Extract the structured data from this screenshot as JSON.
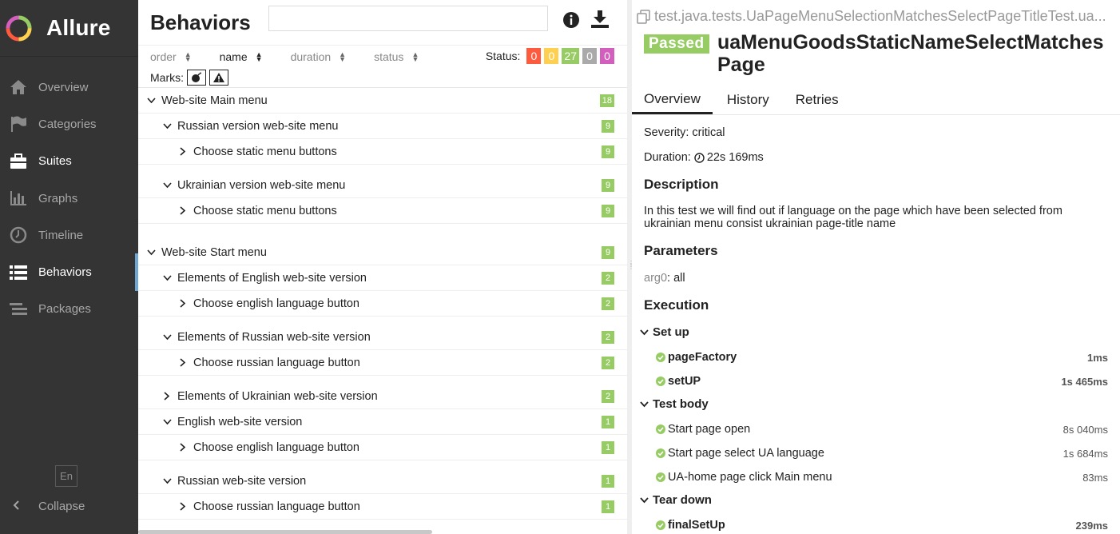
{
  "app": {
    "name": "Allure",
    "colors": {
      "sidebar": "#343434",
      "passed": "#97cc64",
      "failed": "#fd5a3e",
      "broken": "#ffd050",
      "skipped": "#aaaaaa",
      "unknown": "#d35ebe",
      "selected": "#6ea6d4"
    }
  },
  "sidebar": {
    "items": [
      {
        "label": "Overview",
        "icon": "home-icon"
      },
      {
        "label": "Categories",
        "icon": "flag-icon"
      },
      {
        "label": "Suites",
        "icon": "briefcase-icon"
      },
      {
        "label": "Graphs",
        "icon": "bar-chart-icon"
      },
      {
        "label": "Timeline",
        "icon": "clock-icon"
      },
      {
        "label": "Behaviors",
        "icon": "list-icon"
      },
      {
        "label": "Packages",
        "icon": "packages-icon"
      }
    ],
    "language": "En",
    "collapse": "Collapse"
  },
  "middle": {
    "title": "Behaviors",
    "search_value": "",
    "sort": [
      {
        "label": "order"
      },
      {
        "label": "name"
      },
      {
        "label": "duration"
      },
      {
        "label": "status"
      }
    ],
    "status_label": "Status:",
    "status_counts": [
      {
        "value": "0",
        "color": "#fd5a3e"
      },
      {
        "value": "0",
        "color": "#ffd050"
      },
      {
        "value": "27",
        "color": "#97cc64"
      },
      {
        "value": "0",
        "color": "#aaaaaa"
      },
      {
        "value": "0",
        "color": "#d35ebe"
      }
    ],
    "marks_label": "Marks:",
    "tree": [
      {
        "label": "Web-site Main menu",
        "count": "18",
        "level": 0,
        "expanded": true
      },
      {
        "label": "Russian version web-site menu",
        "count": "9",
        "level": 1,
        "expanded": true
      },
      {
        "label": "Choose static menu buttons",
        "count": "9",
        "level": 2,
        "expanded": false
      },
      {
        "label": "Ukrainian version web-site menu",
        "count": "9",
        "level": 1,
        "expanded": true
      },
      {
        "label": "Choose static menu buttons",
        "count": "9",
        "level": 2,
        "expanded": false
      },
      {
        "label": "Web-site Start menu",
        "count": "9",
        "level": 0,
        "expanded": true
      },
      {
        "label": "Elements of English web-site version",
        "count": "2",
        "level": 1,
        "expanded": true
      },
      {
        "label": "Choose english language button",
        "count": "2",
        "level": 2,
        "expanded": false
      },
      {
        "label": "Elements of Russian web-site version",
        "count": "2",
        "level": 1,
        "expanded": true
      },
      {
        "label": "Choose russian language button",
        "count": "2",
        "level": 2,
        "expanded": false
      },
      {
        "label": "Elements of Ukrainian web-site version",
        "count": "2",
        "level": 1,
        "expanded": false
      },
      {
        "label": "English web-site version",
        "count": "1",
        "level": 1,
        "expanded": true
      },
      {
        "label": "Choose english language button",
        "count": "1",
        "level": 2,
        "expanded": false
      },
      {
        "label": "Russian web-site version",
        "count": "1",
        "level": 1,
        "expanded": true
      },
      {
        "label": "Choose russian language button",
        "count": "1",
        "level": 2,
        "expanded": false
      }
    ]
  },
  "detail": {
    "path": "test.java.tests.UaPageMenuSelectionMatchesSelectPageTitleTest.ua...",
    "status": "Passed",
    "name": "uaMenuGoodsStaticNameSelectMatchesPage",
    "tabs": [
      "Overview",
      "History",
      "Retries"
    ],
    "severity": "Severity: critical",
    "duration_label": "Duration:",
    "duration": "22s 169ms",
    "description_title": "Description",
    "description": "In this test we will find out if language on the page which have been selected from ukrainian menu consist ukrainian page-title name",
    "parameters_title": "Parameters",
    "param_key": "arg0",
    "param_value": ": all",
    "execution_title": "Execution",
    "groups": [
      {
        "title": "Set up",
        "steps": [
          {
            "name": "pageFactory",
            "time": "1ms"
          },
          {
            "name": "setUP",
            "time": "1s 465ms"
          }
        ]
      },
      {
        "title": "Test body",
        "steps": [
          {
            "name": "Start page open",
            "time": "8s 040ms"
          },
          {
            "name": "Start page select UA language",
            "time": "1s 684ms"
          },
          {
            "name": "UA-home page click Main menu",
            "time": "83ms"
          }
        ]
      },
      {
        "title": "Tear down",
        "steps": [
          {
            "name": "finalSetUp",
            "time": "239ms"
          }
        ]
      }
    ]
  }
}
